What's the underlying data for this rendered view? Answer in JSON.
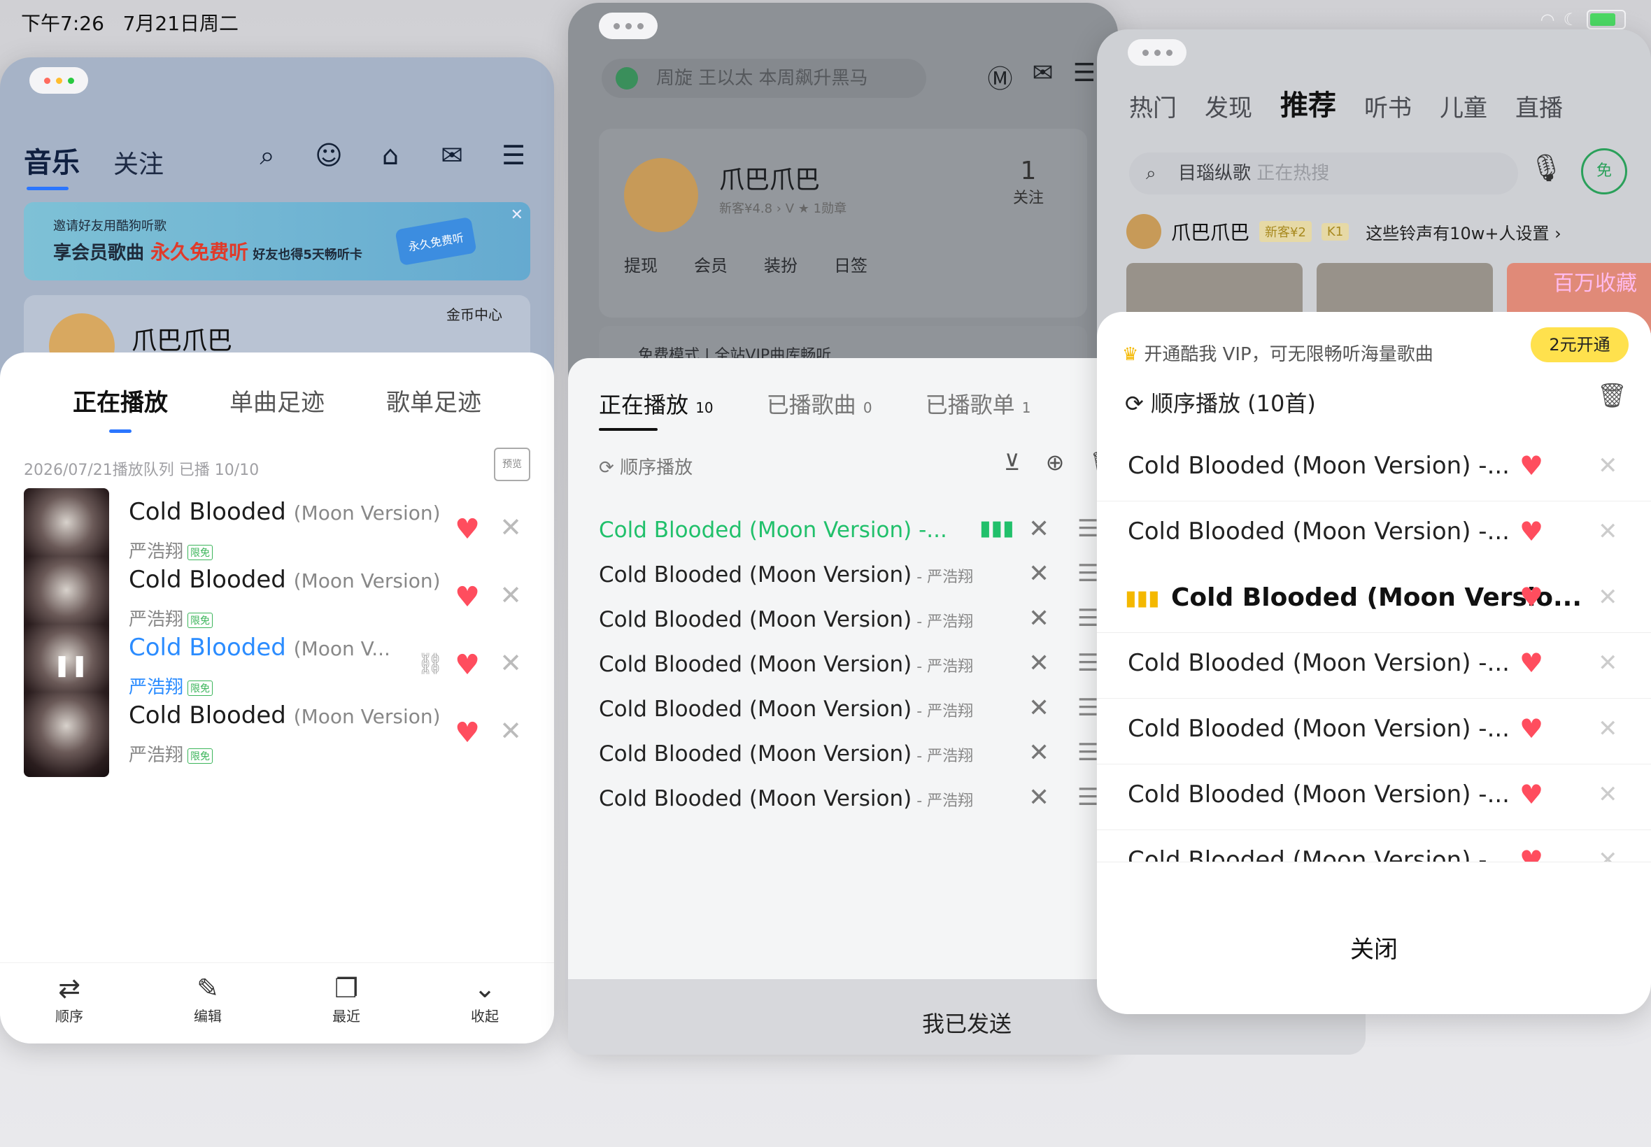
{
  "status": {
    "time": "下午7:26",
    "date": "7月21日周二"
  },
  "w1": {
    "nav": {
      "music": "音乐",
      "follow": "关注"
    },
    "banner": {
      "line1": "邀请好友用酷狗听歌",
      "line2a": "享会员歌曲 ",
      "line2b": "永久免费听",
      "line2c": " 好友也得5天畅听卡",
      "badge": "永久免费听"
    },
    "user": {
      "name": "爪巴爪巴",
      "coins": "金币中心"
    },
    "tabs": [
      "正在播放",
      "单曲足迹",
      "歌单足迹"
    ],
    "queue_meta": "2026/07/21播放队列  已播 10/10",
    "preview": "预览",
    "songs": [
      {
        "title": "Cold Blooded",
        "sub": "(Moon Version)",
        "artist": "严浩翔",
        "tag": "限免"
      },
      {
        "title": "Cold Blooded",
        "sub": "(Moon Version)",
        "artist": "严浩翔",
        "tag": "限免"
      },
      {
        "title": "Cold Blooded",
        "sub": "(Moon V...",
        "artist": "严浩翔",
        "tag": "限免"
      },
      {
        "title": "Cold Blooded",
        "sub": "(Moon Version)",
        "artist": "严浩翔",
        "tag": "限免"
      }
    ],
    "bottom": [
      {
        "icon": "⇄",
        "label": "顺序"
      },
      {
        "icon": "✎",
        "label": "编辑"
      },
      {
        "icon": "❐",
        "label": "最近"
      },
      {
        "icon": "⌄",
        "label": "收起"
      }
    ]
  },
  "w2": {
    "search": "周旋 王以太  本周飙升黑马",
    "user": {
      "name": "爪巴爪巴",
      "badges": "新客¥4.8 ›   V   ★ 1勋章",
      "follow_count": "1",
      "follow_label": "关注"
    },
    "actions": [
      "提现",
      "会员",
      "装扮",
      "日签"
    ],
    "promo": "免费模式 | 全站VIP曲库畅听",
    "tabs": [
      {
        "label": "正在播放",
        "count": "10"
      },
      {
        "label": "已播歌曲",
        "count": "0"
      },
      {
        "label": "已播歌单",
        "count": "1"
      }
    ],
    "mode": "顺序播放",
    "songs": [
      "Cold Blooded (Moon Version) -...",
      "Cold Blooded (Moon Version)",
      "Cold Blooded (Moon Version)",
      "Cold Blooded (Moon Version)",
      "Cold Blooded (Moon Version)",
      "Cold Blooded (Moon Version)",
      "Cold Blooded (Moon Version)"
    ],
    "artist_suffix": " - 严浩翔",
    "sent": "我已发送"
  },
  "w3": {
    "nav": [
      "热门",
      "发现",
      "推荐",
      "听书",
      "儿童",
      "直播"
    ],
    "search": "目瑙纵歌",
    "search_hint": " 正在热搜",
    "free_label": "免",
    "user": {
      "name": "爪巴爪巴",
      "level": "新客¥2",
      "k": "K1",
      "ringtone": "这些铃声有10w+人设置 ›"
    },
    "cards": [
      "",
      "",
      "百万收藏"
    ],
    "vip_text": "开通酷我 VIP，可无限畅听海量歌曲",
    "vip_btn": "2元开通",
    "mode": "顺序播放 (10首)",
    "songs": [
      "Cold Blooded (Moon Version) -...",
      "Cold Blooded (Moon Version) -...",
      "Cold Blooded (Moon Versio...",
      "Cold Blooded (Moon Version) -...",
      "Cold Blooded (Moon Version) -...",
      "Cold Blooded (Moon Version) -...",
      "Cold Blooded (Moon Version) -"
    ],
    "close": "关闭"
  }
}
